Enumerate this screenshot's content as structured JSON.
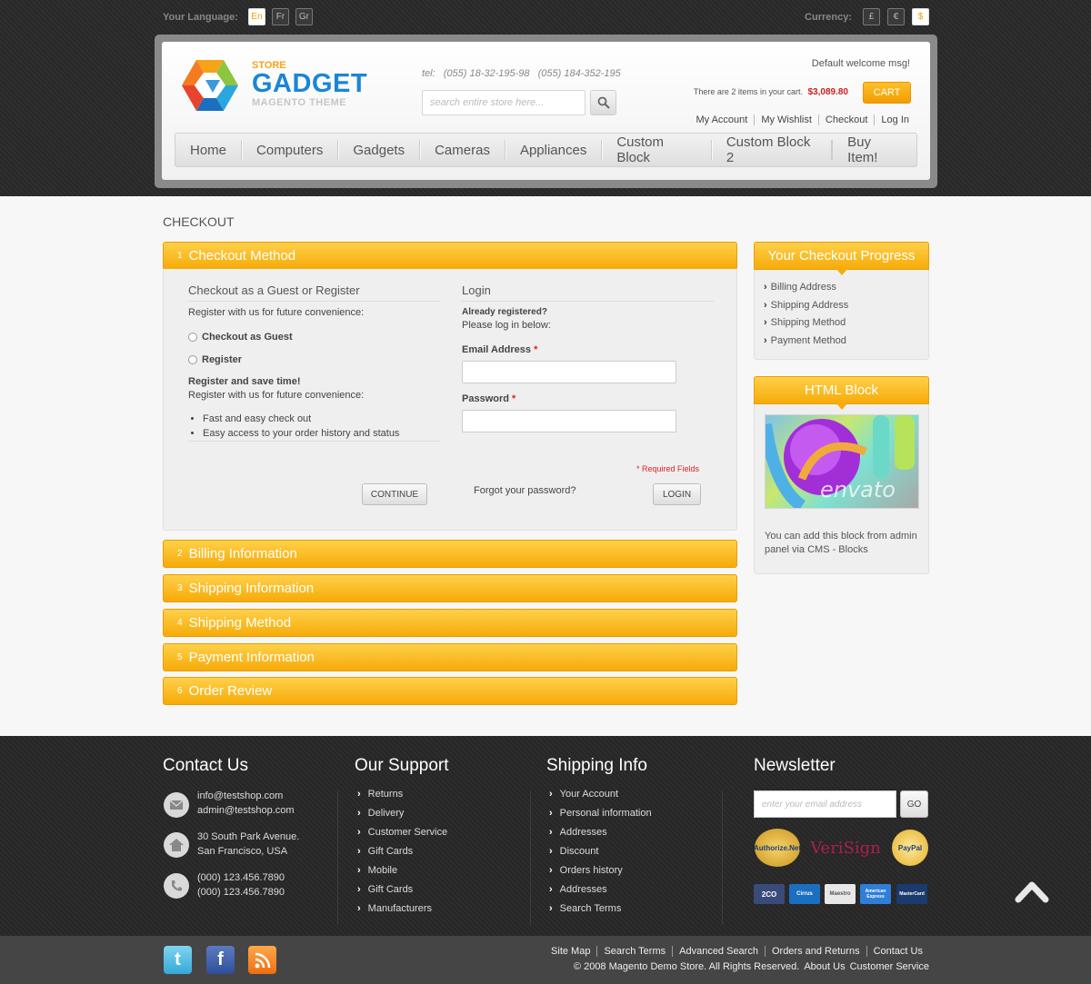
{
  "topbar": {
    "language_label": "Your Language:",
    "languages": [
      "En",
      "Fr",
      "Gr"
    ],
    "currency_label": "Currency:",
    "currencies": [
      "£",
      "€",
      "$"
    ]
  },
  "brand": {
    "store": "STORE",
    "name": "GADGET",
    "sub": "MAGENTO THEME"
  },
  "header": {
    "tel_label": "tel:",
    "tel1": "(055) 18-32-195-98",
    "tel2": "(055) 184-352-195",
    "search_placeholder": "search entire store here...",
    "welcome": "Default welcome msg!",
    "cart_text_pre": "There are",
    "cart_count": "2 items",
    "cart_text_post": "in your cart.",
    "cart_price": "$3,089.80",
    "cart_button": "CART",
    "links": [
      "My Account",
      "My Wishlist",
      "Checkout",
      "Log In"
    ]
  },
  "nav": {
    "items": [
      "Home",
      "Computers",
      "Gadgets",
      "Cameras",
      "Appliances",
      "Custom Block",
      "Custom Block 2"
    ],
    "buy": "Buy Item!"
  },
  "page": {
    "title": "CHECKOUT"
  },
  "steps": [
    {
      "num": "1",
      "label": "Checkout Method"
    },
    {
      "num": "2",
      "label": "Billing Information"
    },
    {
      "num": "3",
      "label": "Shipping Information"
    },
    {
      "num": "4",
      "label": "Shipping Method"
    },
    {
      "num": "5",
      "label": "Payment Information"
    },
    {
      "num": "6",
      "label": "Order Review"
    }
  ],
  "method": {
    "guest_title": "Checkout as a Guest or Register",
    "guest_intro": "Register with us for future convenience:",
    "radio_guest": "Checkout as Guest",
    "radio_register": "Register",
    "save_time": "Register and save time!",
    "save_time_sub": "Register with us for future convenience:",
    "bullets": [
      "Fast and easy check out",
      "Easy access to your order history and status"
    ],
    "continue": "CONTINUE",
    "login_title": "Login",
    "already": "Already registered?",
    "please": "Please log in below:",
    "email_label": "Email Address",
    "password_label": "Password",
    "required_star": "*",
    "required_note": "* Required Fields",
    "forgot": "Forgot your password?",
    "login_button": "LOGIN"
  },
  "sidebar": {
    "progress_title": "Your Checkout Progress",
    "progress_items": [
      "Billing Address",
      "Shipping Address",
      "Shipping Method",
      "Payment Method"
    ],
    "html_title": "HTML Block",
    "envato_text": "envato",
    "html_note": "You can add this block from admin panel via CMS - Blocks"
  },
  "footer": {
    "contact_title": "Contact Us",
    "email1": "info@testshop.com",
    "email2": "admin@testshop.com",
    "address1": "30 South Park Avenue.",
    "address2": "San Francisco, USA",
    "phone1": "(000) 123.456.7890",
    "phone2": "(000) 123.456.7890",
    "support_title": "Our Support",
    "support_items": [
      "Returns",
      "Delivery",
      "Customer Service",
      "Gift Cards",
      "Mobile",
      "Gift Cards",
      "Manufacturers"
    ],
    "shipping_title": "Shipping Info",
    "shipping_items": [
      "Your Account",
      "Personal information",
      "Addresses",
      "Discount",
      "Orders history",
      "Addresses",
      "Search Terms"
    ],
    "newsletter_title": "Newsletter",
    "newsletter_placeholder": "enter your email address",
    "newsletter_go": "GO",
    "badges": [
      "Authorize.Net",
      "VeriSign",
      "PayPal"
    ],
    "cards": [
      "2CO",
      "Cirrus",
      "Maestro",
      "American Express",
      "MasterCard"
    ]
  },
  "bottom": {
    "links": [
      "Site Map",
      "Search Terms",
      "Advanced Search",
      "Orders and Returns",
      "Contact Us"
    ],
    "copyright": "© 2008 Magento Demo Store. All Rights Reserved.",
    "about": "About Us",
    "service": "Customer Service"
  },
  "colors": {
    "accent": "#f6ab08",
    "brand_blue": "#1a86d6",
    "price_red": "#d11d1d",
    "footer_dark": "#2a2a2a"
  }
}
